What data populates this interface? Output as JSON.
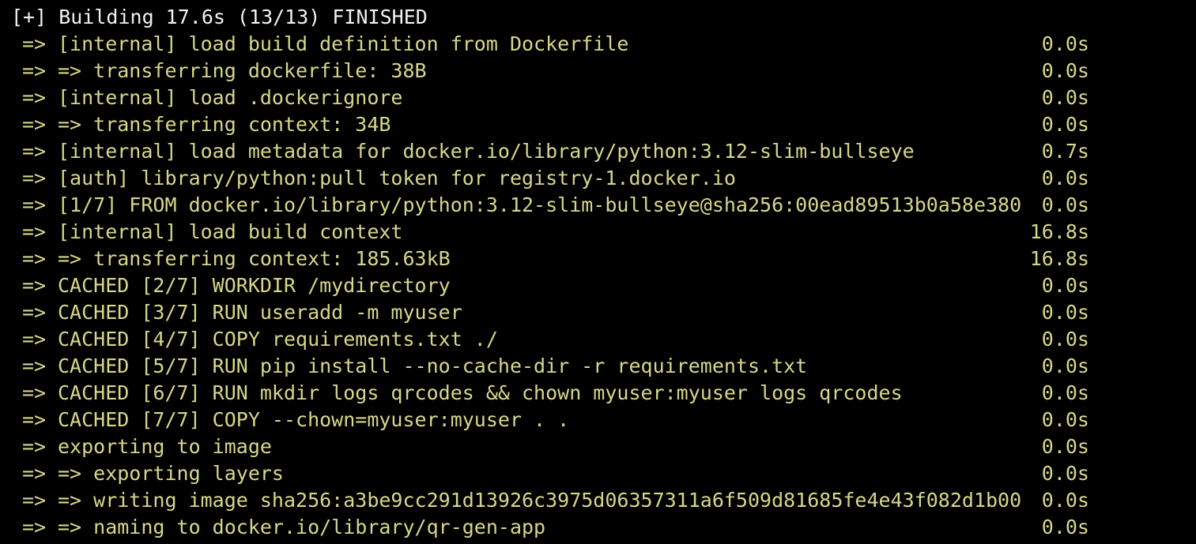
{
  "theme": {
    "background": "#000000",
    "header_color": "#f2f2f2",
    "log_color": "#d7d78a"
  },
  "header": {
    "text": "[+] Building 17.6s (13/13) FINISHED"
  },
  "log_prefix": "=>",
  "steps": [
    {
      "text": "[internal] load build definition from Dockerfile",
      "duration": "0.0s"
    },
    {
      "text": "=> transferring dockerfile: 38B",
      "duration": "0.0s"
    },
    {
      "text": "[internal] load .dockerignore",
      "duration": "0.0s"
    },
    {
      "text": "=> transferring context: 34B",
      "duration": "0.0s"
    },
    {
      "text": "[internal] load metadata for docker.io/library/python:3.12-slim-bullseye",
      "duration": "0.7s"
    },
    {
      "text": "[auth] library/python:pull token for registry-1.docker.io",
      "duration": "0.0s"
    },
    {
      "text": "[1/7] FROM docker.io/library/python:3.12-slim-bullseye@sha256:00ead89513b0a58e380",
      "duration": "0.0s"
    },
    {
      "text": "[internal] load build context",
      "duration": "16.8s"
    },
    {
      "text": "=> transferring context: 185.63kB",
      "duration": "16.8s"
    },
    {
      "text": "CACHED [2/7] WORKDIR /mydirectory",
      "duration": "0.0s"
    },
    {
      "text": "CACHED [3/7] RUN useradd -m myuser",
      "duration": "0.0s"
    },
    {
      "text": "CACHED [4/7] COPY requirements.txt ./",
      "duration": "0.0s"
    },
    {
      "text": "CACHED [5/7] RUN pip install --no-cache-dir -r requirements.txt",
      "duration": "0.0s"
    },
    {
      "text": "CACHED [6/7] RUN mkdir logs qrcodes && chown myuser:myuser logs qrcodes",
      "duration": "0.0s"
    },
    {
      "text": "CACHED [7/7] COPY --chown=myuser:myuser . .",
      "duration": "0.0s"
    },
    {
      "text": "exporting to image",
      "duration": "0.0s"
    },
    {
      "text": "=> exporting layers",
      "duration": "0.0s"
    },
    {
      "text": "=> writing image sha256:a3be9cc291d13926c3975d06357311a6f509d81685fe4e43f082d1b00",
      "duration": "0.0s"
    },
    {
      "text": "=> naming to docker.io/library/qr-gen-app",
      "duration": "0.0s"
    }
  ]
}
